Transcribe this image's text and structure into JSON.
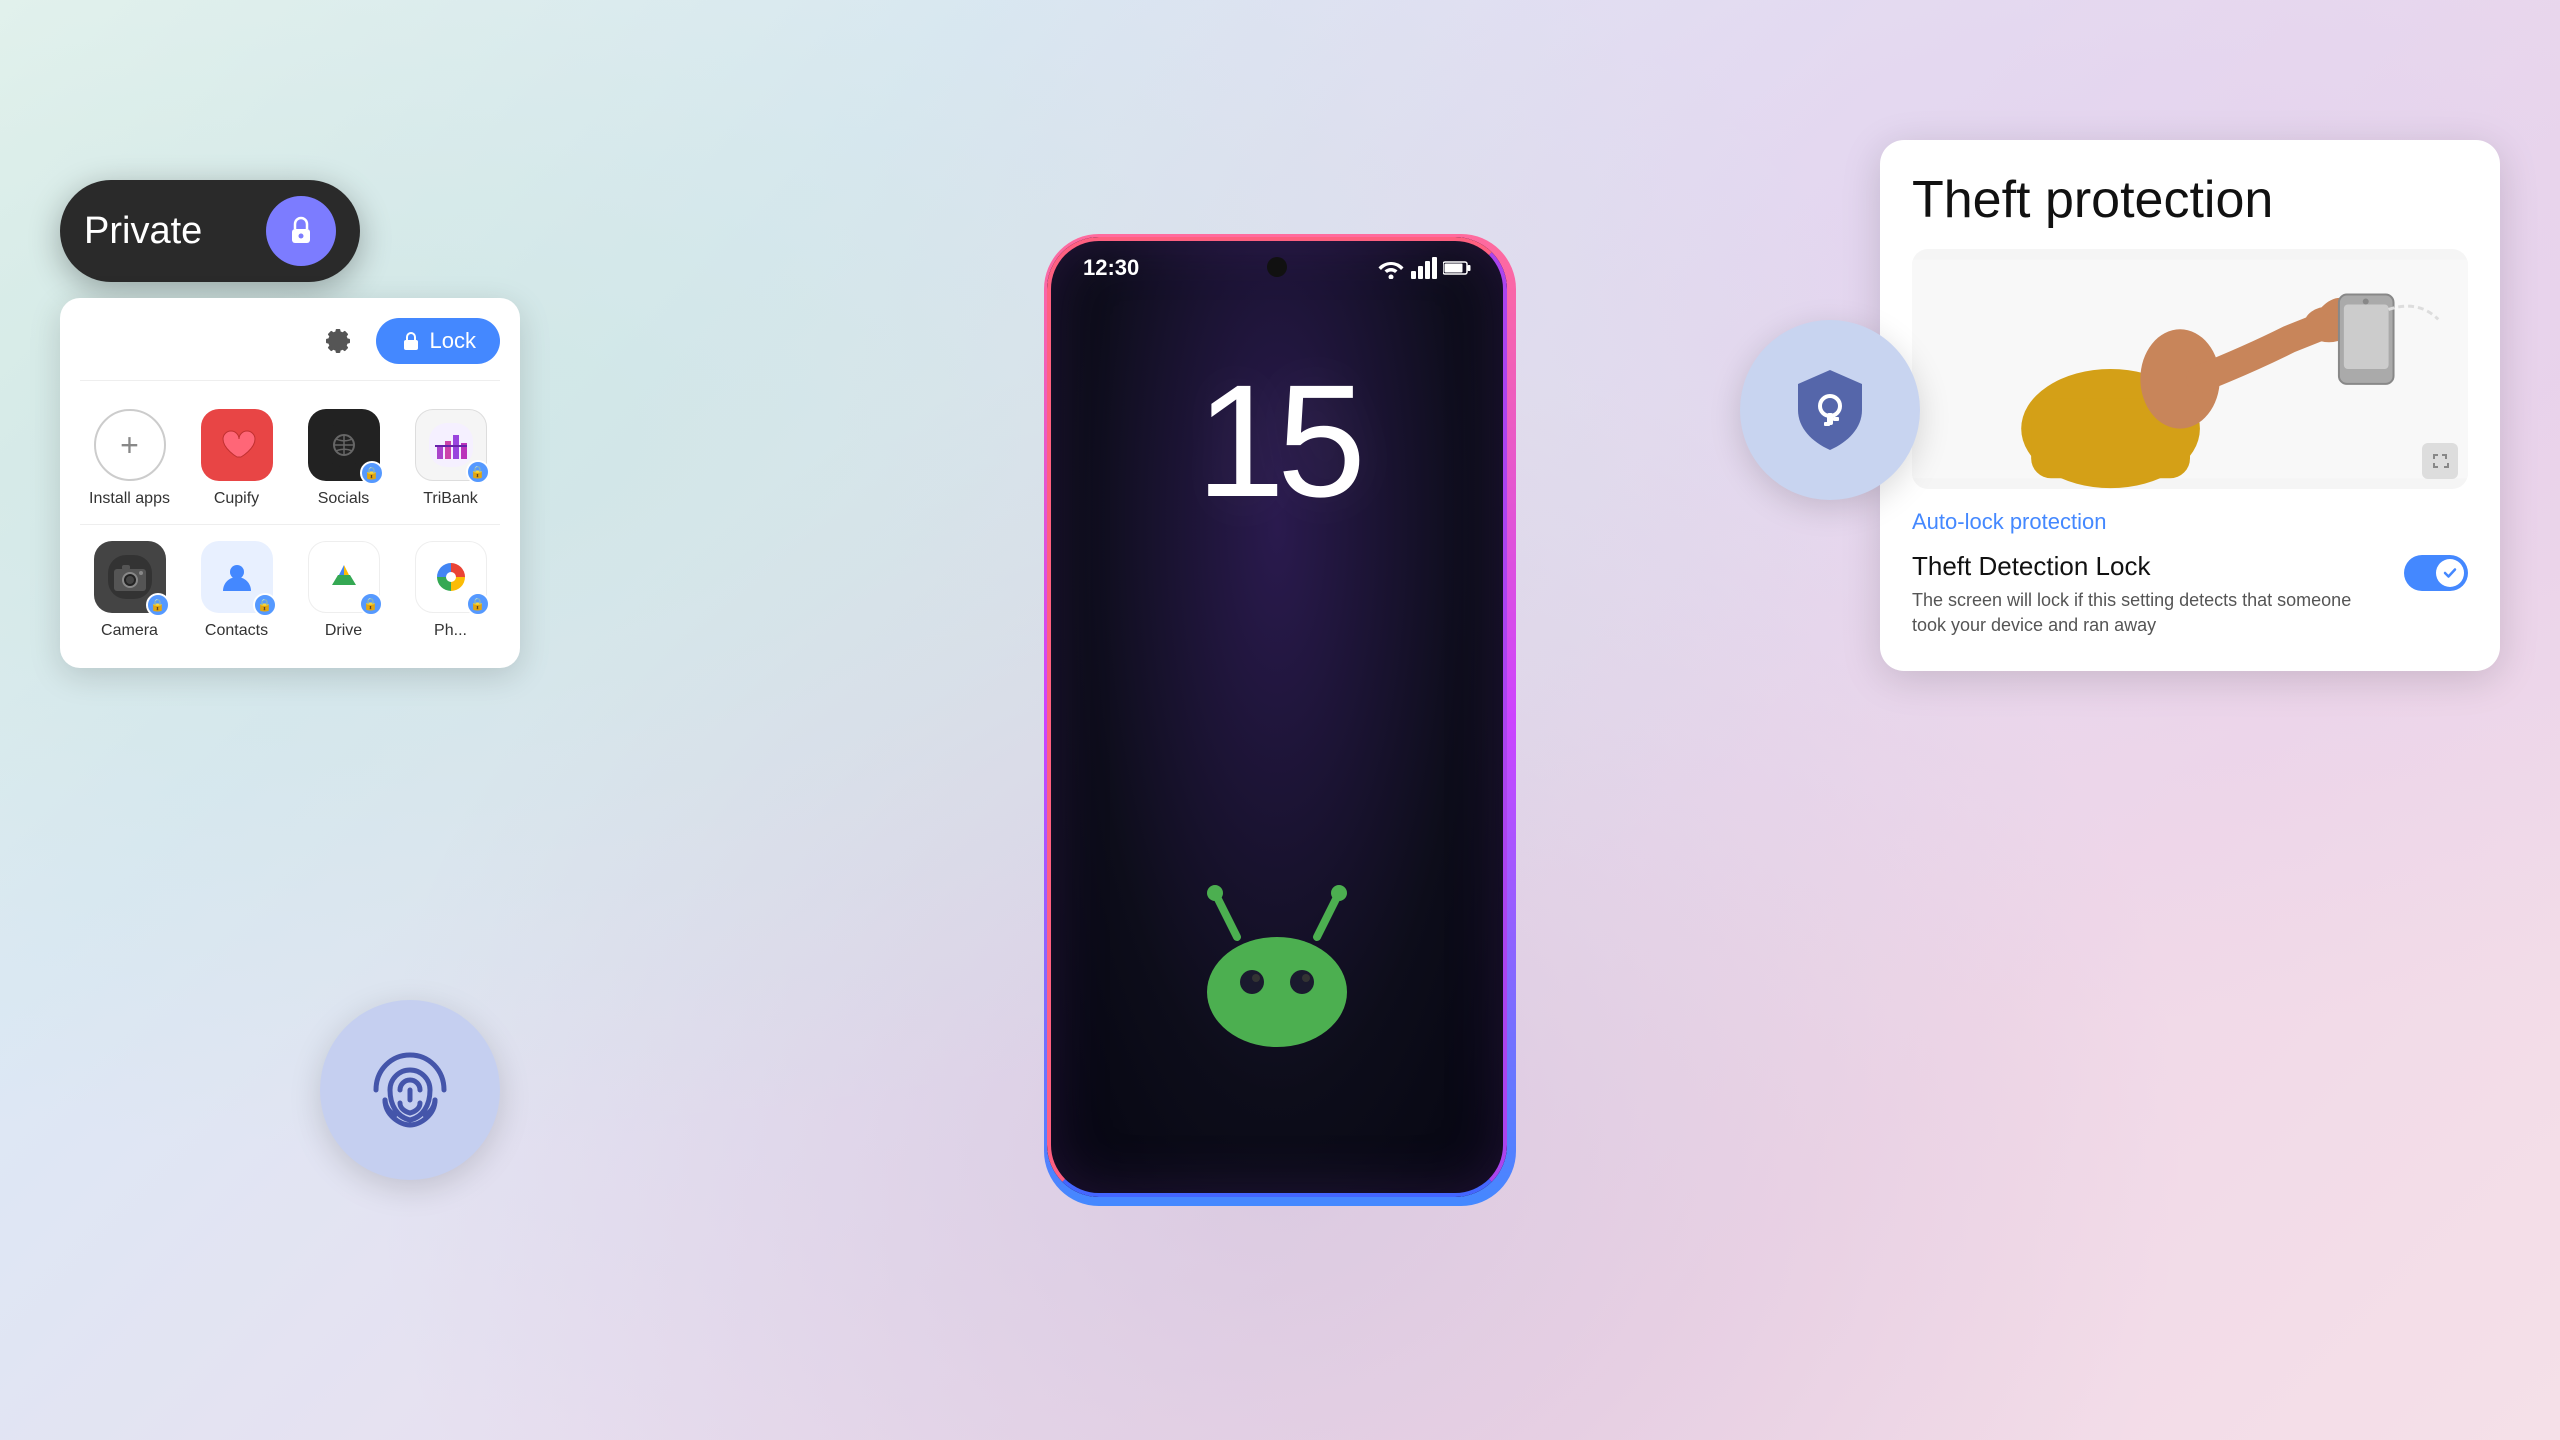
{
  "background": {
    "gradient_desc": "light teal-to-lavender gradient background"
  },
  "phone": {
    "status_bar": {
      "time": "12:30",
      "wifi_icon": "▼",
      "signal_icon": "▲",
      "battery_icon": "▮"
    },
    "clock": "15",
    "android_mascot_alt": "Android robot mascot green"
  },
  "left_panel": {
    "private_toggle": {
      "label": "Private",
      "icon": "🔒"
    },
    "header": {
      "settings_icon": "⚙",
      "lock_button": "Lock",
      "lock_icon": "🔒"
    },
    "app_grid_row1": [
      {
        "name": "Install apps",
        "icon": "+",
        "type": "plus"
      },
      {
        "name": "Cupify",
        "icon": "❤",
        "color": "#e84545",
        "has_privacy": false
      },
      {
        "name": "Socials",
        "icon": "◐",
        "color": "#333",
        "has_privacy": true
      },
      {
        "name": "TriBank",
        "icon": "◧",
        "color": "#555",
        "has_privacy": true
      }
    ],
    "app_grid_row2": [
      {
        "name": "Camera",
        "icon": "📷",
        "color": "#555",
        "has_privacy": true
      },
      {
        "name": "Contacts",
        "icon": "👤",
        "color": "#4488ff",
        "has_privacy": true
      },
      {
        "name": "Drive",
        "icon": "△",
        "color": "multicolor",
        "has_privacy": true
      },
      {
        "name": "Photos",
        "icon": "✿",
        "color": "multicolor",
        "has_privacy": true
      }
    ]
  },
  "fingerprint_bubble": {
    "icon": "fingerprint",
    "aria": "Fingerprint security feature"
  },
  "right_panel": {
    "theft_protection": {
      "title": "Theft protection",
      "image_alt": "Illustration of theft protection showing hand grabbing phone",
      "auto_lock_label": "Auto-lock protection",
      "detection_lock": {
        "title": "Theft Detection Lock",
        "description": "The screen will lock if this setting detects that someone took your device and ran away",
        "toggle_enabled": true,
        "toggle_check": "✓"
      }
    }
  },
  "shield_bubble": {
    "icon": "shield with key",
    "aria": "Security shield icon"
  }
}
